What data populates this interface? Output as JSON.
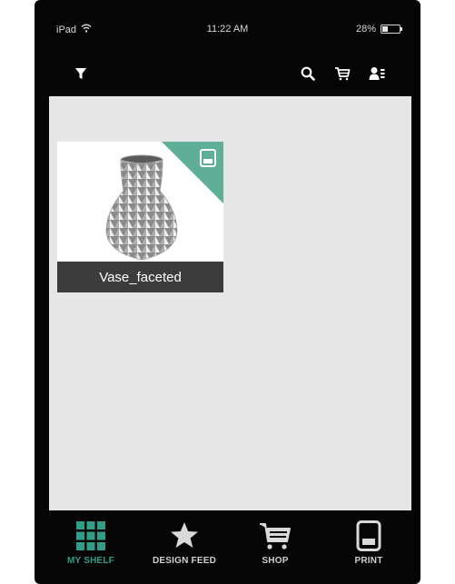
{
  "status_bar": {
    "device": "iPad",
    "time": "11:22 AM",
    "battery": "28%",
    "battery_level": 0.28
  },
  "toolbar": {
    "icons": [
      "filter-icon",
      "search-icon",
      "cart-icon",
      "profile-icon"
    ]
  },
  "shelf": {
    "items": [
      {
        "name": "Vase_faceted",
        "icon": "printable-icon"
      }
    ]
  },
  "tabbar": {
    "tabs": [
      {
        "label": "MY SHELF",
        "icon": "grid-icon",
        "active": true
      },
      {
        "label": "DESIGN FEED",
        "icon": "star-icon",
        "active": false
      },
      {
        "label": "SHOP",
        "icon": "cart-icon",
        "active": false
      },
      {
        "label": "PRINT",
        "icon": "printer-icon",
        "active": false
      }
    ]
  },
  "colors": {
    "accent": "#2f9f8a",
    "corner": "#5fae97",
    "background": "#050505",
    "content": "#e6e6e6",
    "label_bar": "#3c3c3c"
  }
}
